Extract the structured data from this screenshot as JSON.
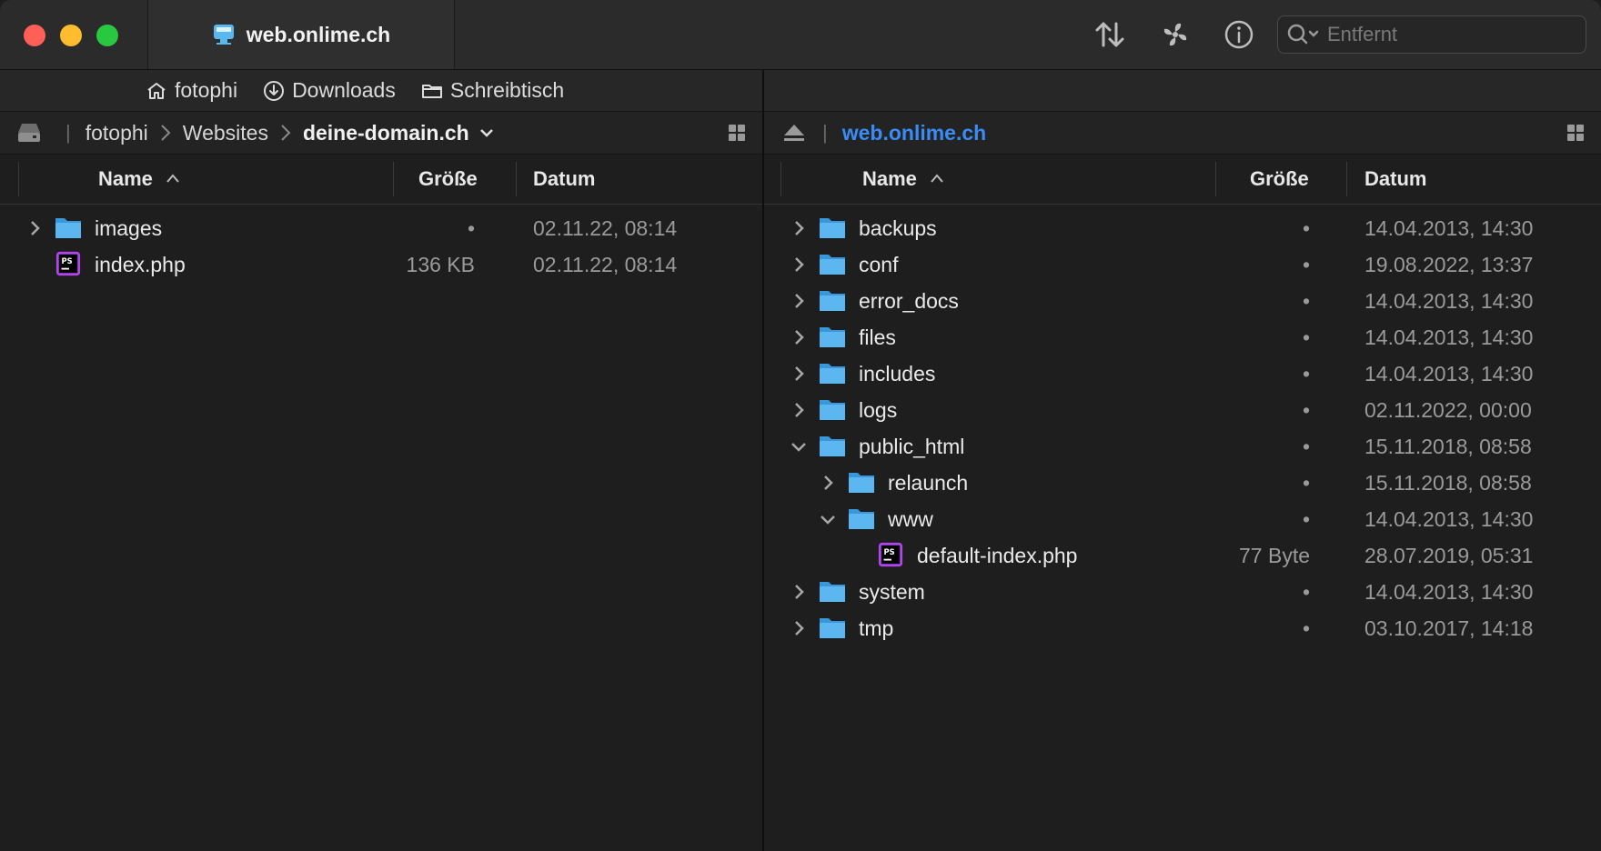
{
  "window": {
    "tab_title": "web.onlime.ch",
    "search_placeholder": "Entfernt"
  },
  "left": {
    "favorites": [
      "fotophi",
      "Downloads",
      "Schreibtisch"
    ],
    "path": [
      "fotophi",
      "Websites",
      "deine-domain.ch"
    ],
    "columns": {
      "name": "Name",
      "size": "Größe",
      "date": "Datum"
    },
    "rows": [
      {
        "name": "images",
        "size": "•",
        "date": "02.11.22, 08:14"
      },
      {
        "name": "index.php",
        "size": "136 KB",
        "date": "02.11.22, 08:14"
      }
    ]
  },
  "right": {
    "path": "web.onlime.ch",
    "columns": {
      "name": "Name",
      "size": "Größe",
      "date": "Datum"
    },
    "rows": [
      {
        "name": "backups",
        "size": "•",
        "date": "14.04.2013, 14:30"
      },
      {
        "name": "conf",
        "size": "•",
        "date": "19.08.2022, 13:37"
      },
      {
        "name": "error_docs",
        "size": "•",
        "date": "14.04.2013, 14:30"
      },
      {
        "name": "files",
        "size": "•",
        "date": "14.04.2013, 14:30"
      },
      {
        "name": "includes",
        "size": "•",
        "date": "14.04.2013, 14:30"
      },
      {
        "name": "logs",
        "size": "•",
        "date": "02.11.2022, 00:00"
      },
      {
        "name": "public_html",
        "size": "•",
        "date": "15.11.2018, 08:58"
      },
      {
        "name": "relaunch",
        "size": "•",
        "date": "15.11.2018, 08:58"
      },
      {
        "name": "www",
        "size": "•",
        "date": "14.04.2013, 14:30"
      },
      {
        "name": "default-index.php",
        "size": "77 Byte",
        "date": "28.07.2019, 05:31"
      },
      {
        "name": "system",
        "size": "•",
        "date": "14.04.2013, 14:30"
      },
      {
        "name": "tmp",
        "size": "•",
        "date": "03.10.2017, 14:18"
      }
    ]
  },
  "colors": {
    "accent": "#3a8cf5",
    "folder": "#4aa9e9"
  }
}
